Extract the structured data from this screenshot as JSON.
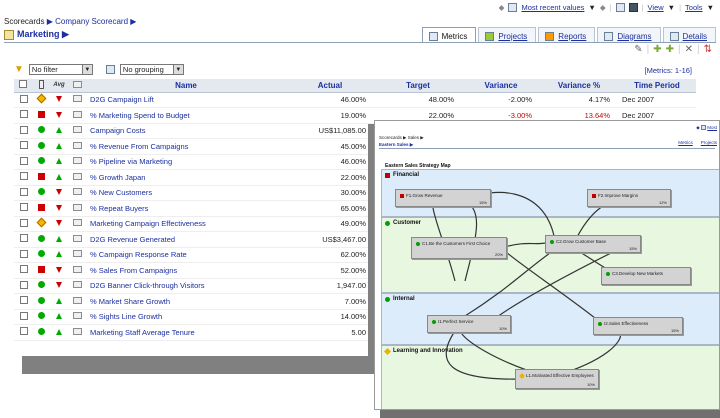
{
  "toolbar": {
    "most_recent": "Most recent values",
    "view": "View",
    "tools": "Tools"
  },
  "breadcrumb": {
    "scorecards": "Scorecards",
    "company": "Company Scorecard"
  },
  "page_title": "Marketing",
  "tabs": [
    "Metrics",
    "Projects",
    "Reports",
    "Diagrams",
    "Details"
  ],
  "filters": {
    "filter": "No filter",
    "grouping": "No grouping"
  },
  "metrics_count": "[Metrics: 1-16]",
  "columns": [
    "Name",
    "Actual",
    "Target",
    "Variance",
    "Variance %",
    "Time Period"
  ],
  "rows": [
    {
      "status": "diamond",
      "trend": "down",
      "name": "D2G Campaign Lift",
      "actual": "46.00%",
      "target": "48.00%",
      "variance": "-2.00%",
      "variance_pct": "4.17%",
      "period": "Dec 2007",
      "neg": false
    },
    {
      "status": "red",
      "trend": "down",
      "name": "% Marketing Spend to Budget",
      "actual": "19.00%",
      "target": "22.00%",
      "variance": "-3.00%",
      "variance_pct": "13.64%",
      "period": "Dec 2007",
      "neg": true
    },
    {
      "status": "green",
      "trend": "up",
      "name": "Campaign Costs",
      "actual": "US$11,085.00",
      "target": "",
      "variance": "",
      "variance_pct": "",
      "period": "",
      "neg": false
    },
    {
      "status": "green",
      "trend": "up",
      "name": "% Revenue From Campaigns",
      "actual": "45.00%",
      "target": "",
      "variance": "",
      "variance_pct": "",
      "period": "",
      "neg": false
    },
    {
      "status": "green",
      "trend": "up",
      "name": "% Pipeline via Marketing",
      "actual": "46.00%",
      "target": "",
      "variance": "",
      "variance_pct": "",
      "period": "",
      "neg": false
    },
    {
      "status": "red",
      "trend": "up",
      "name": "% Growth Japan",
      "actual": "22.00%",
      "target": "",
      "variance": "",
      "variance_pct": "",
      "period": "",
      "neg": false
    },
    {
      "status": "green",
      "trend": "down",
      "name": "% New Customers",
      "actual": "30.00%",
      "target": "",
      "variance": "",
      "variance_pct": "",
      "period": "",
      "neg": false
    },
    {
      "status": "red",
      "trend": "down",
      "name": "% Repeat Buyers",
      "actual": "65.00%",
      "target": "",
      "variance": "",
      "variance_pct": "",
      "period": "",
      "neg": false
    },
    {
      "status": "diamond",
      "trend": "down",
      "name": "Marketing Campaign Effectiveness",
      "actual": "49.00%",
      "target": "",
      "variance": "",
      "variance_pct": "",
      "period": "",
      "neg": false
    },
    {
      "status": "green",
      "trend": "up",
      "name": "D2G Revenue Generated",
      "actual": "US$3,467.00",
      "target": "",
      "variance": "",
      "variance_pct": "",
      "period": "",
      "neg": false
    },
    {
      "status": "green",
      "trend": "up",
      "name": "% Campaign Response Rate",
      "actual": "62.00%",
      "target": "",
      "variance": "",
      "variance_pct": "",
      "period": "",
      "neg": false
    },
    {
      "status": "red",
      "trend": "down",
      "name": "% Sales From Campaigns",
      "actual": "52.00%",
      "target": "",
      "variance": "",
      "variance_pct": "",
      "period": "",
      "neg": false
    },
    {
      "status": "green",
      "trend": "down",
      "name": "D2G Banner Click-through Visitors",
      "actual": "1,947.00",
      "target": "",
      "variance": "",
      "variance_pct": "",
      "period": "",
      "neg": false
    },
    {
      "status": "green",
      "trend": "up",
      "name": "% Market Share Growth",
      "actual": "7.00%",
      "target": "",
      "variance": "",
      "variance_pct": "",
      "period": "",
      "neg": false
    },
    {
      "status": "green",
      "trend": "up",
      "name": "% Sights Line Growth",
      "actual": "14.00%",
      "target": "",
      "variance": "",
      "variance_pct": "",
      "period": "",
      "neg": false
    },
    {
      "status": "green",
      "trend": "up",
      "name": "Marketing Staff Average Tenure",
      "actual": "5.00",
      "target": "",
      "variance": "",
      "variance_pct": "",
      "period": "",
      "neg": false
    }
  ],
  "map": {
    "top_link": "Most",
    "breadcrumb": "Scorecards ▶ Sales ▶",
    "title": "Eastern Sales ▶",
    "tabs": [
      "Metrics",
      "Projects"
    ],
    "name": "Eastern Sales Strategy Map",
    "bands": [
      "Financial",
      "Customer",
      "Internal",
      "Learning and Innovation"
    ],
    "band_colors": [
      "#c00000",
      "#00a000",
      "#00a000",
      "#f0b000"
    ],
    "nodes": [
      {
        "label": "F1.Grow Revenue",
        "pct": "15%",
        "color": "#c00000"
      },
      {
        "label": "F2.Improve Margins",
        "pct": "12%",
        "color": "#c00000"
      },
      {
        "label": "C1.Be the Customers First Choice",
        "pct": "20%",
        "color": "#00a000"
      },
      {
        "label": "C2.Grow Customer Base",
        "pct": "15%",
        "color": "#00a000"
      },
      {
        "label": "C3.Develop New Markets",
        "pct": "",
        "color": "#00a000"
      },
      {
        "label": "I1.Perfect Service",
        "pct": "10%",
        "color": "#00a000"
      },
      {
        "label": "I2.Sales Effectiveness",
        "pct": "15%",
        "color": "#00a000"
      },
      {
        "label": "L1.Motivated Effective Employees",
        "pct": "10%",
        "color": "#f0b000"
      }
    ]
  }
}
